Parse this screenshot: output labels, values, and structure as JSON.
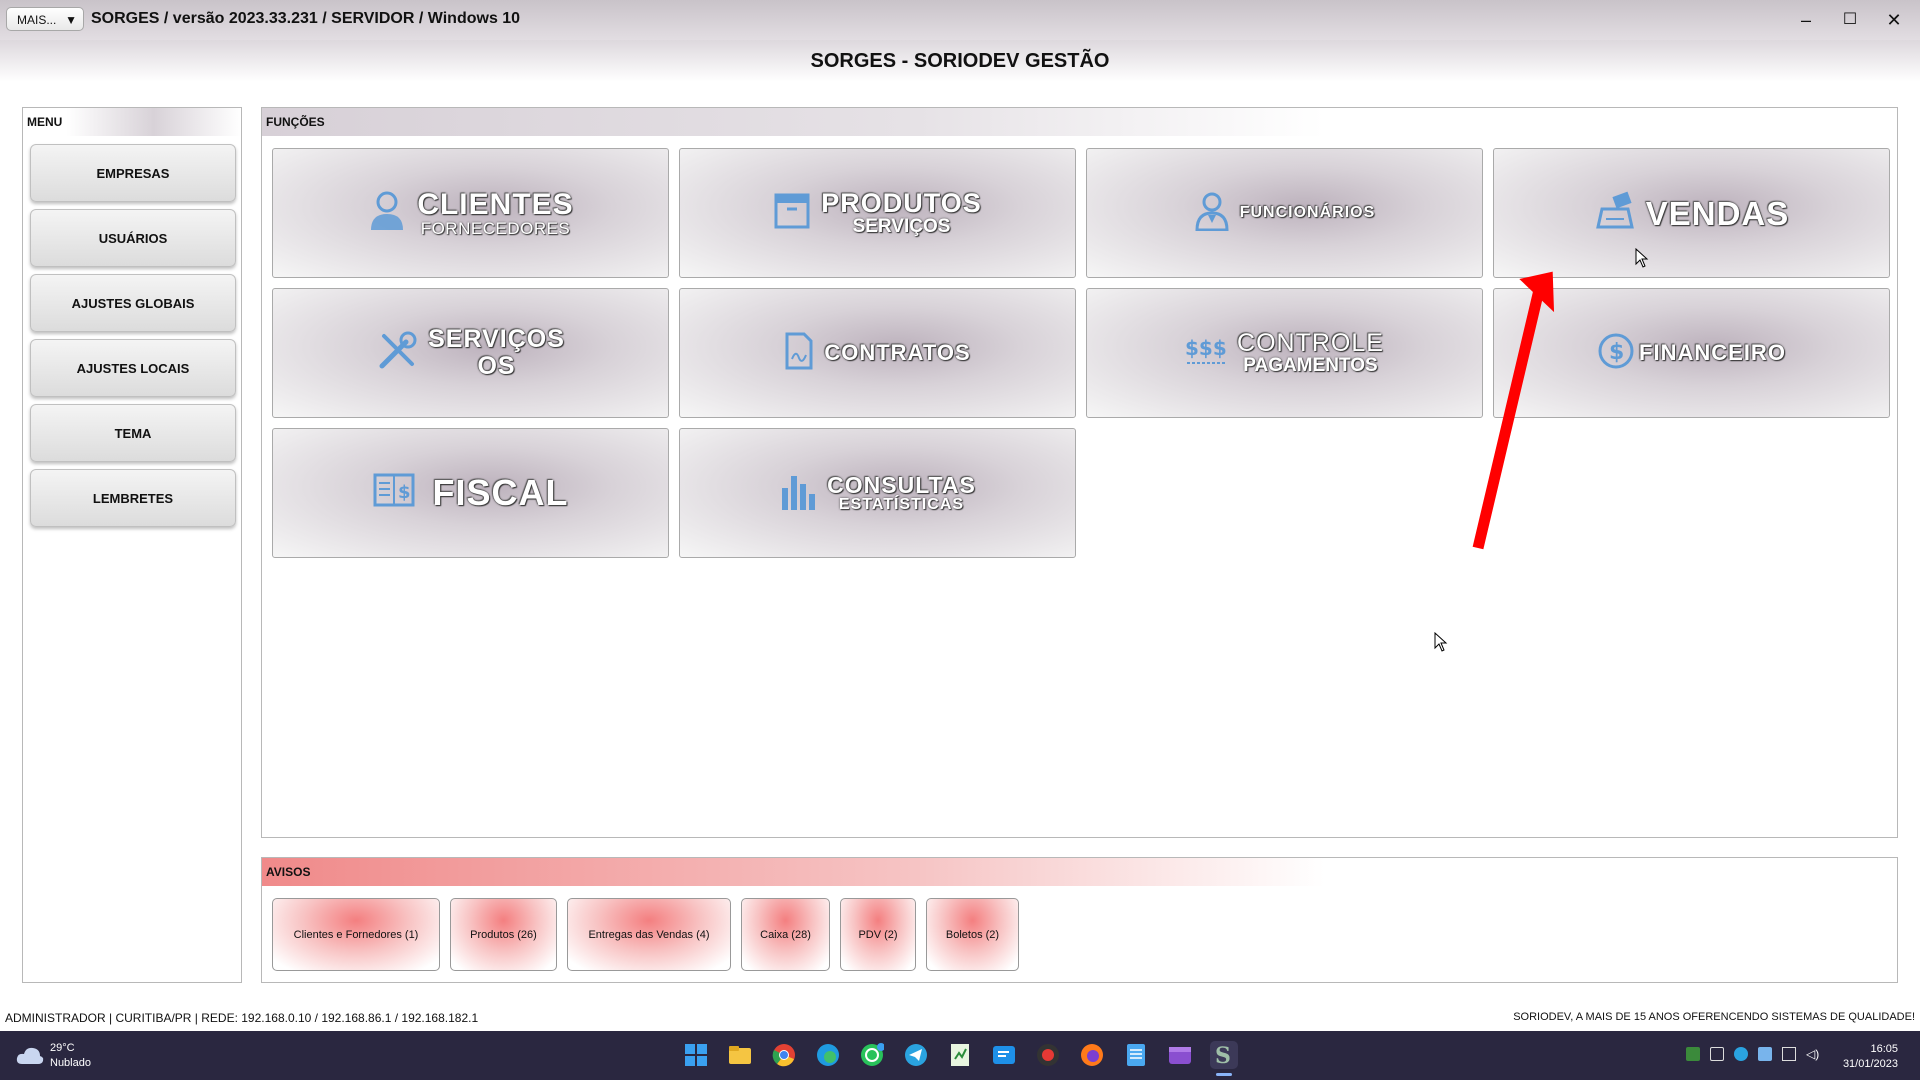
{
  "window": {
    "mais_label": "MAIS...",
    "title": "SORGES / versão 2023.33.231 / SERVIDOR / Windows 10",
    "app_header": "SORGES - SORIODEV GESTÃO",
    "minimize": "–",
    "maximize": "☐",
    "close": "✕"
  },
  "menu": {
    "label": "MENU",
    "items": [
      "EMPRESAS",
      "USUÁRIOS",
      "AJUSTES GLOBAIS",
      "AJUSTES LOCAIS",
      "TEMA",
      "LEMBRETES"
    ]
  },
  "funcoes": {
    "label": "FUNÇÕES",
    "tiles": [
      {
        "main": "CLIENTES",
        "sub": "FORNECEDORES",
        "icon": "person-icon"
      },
      {
        "main": "PRODUTOS",
        "sub": "SERVIÇOS",
        "icon": "box-icon"
      },
      {
        "main": "FUNCIONÁRIOS",
        "sub": "",
        "icon": "employee-icon"
      },
      {
        "main": "VENDAS",
        "sub": "",
        "icon": "cash-register-icon"
      },
      {
        "main": "SERVIÇOS",
        "sub": "OS",
        "icon": "tools-icon"
      },
      {
        "main": "CONTRATOS",
        "sub": "",
        "icon": "contract-icon"
      },
      {
        "main": "CONTROLE",
        "sub": "PAGAMENTOS",
        "icon": "dollar-signs-icon"
      },
      {
        "main": "FINANCEIRO",
        "sub": "",
        "icon": "dollar-coin-icon"
      },
      {
        "main": "FISCAL",
        "sub": "",
        "icon": "fiscal-book-icon"
      },
      {
        "main": "CONSULTAS",
        "sub": "ESTATÍSTICAS",
        "icon": "bar-chart-icon"
      }
    ]
  },
  "avisos": {
    "label": "AVISOS",
    "items": [
      "Clientes e Fornedores (1)",
      "Produtos (26)",
      "Entregas das Vendas (4)",
      "Caixa (28)",
      "PDV (2)",
      "Boletos (2)"
    ]
  },
  "status": {
    "left": "ADMINISTRADOR |   CURITIBA/PR |   REDE: 192.168.0.10 / 192.168.86.1 / 192.168.182.1",
    "right": "SORIODEV, A MAIS DE 15 ANOS OFERENCENDO SISTEMAS DE QUALIDADE!"
  },
  "taskbar": {
    "temperature": "29°C",
    "weather": "Nublado",
    "time": "16:05",
    "date": "31/01/2023",
    "apps": [
      "start-icon",
      "file-explorer-icon",
      "chrome-icon",
      "edge-icon",
      "whatsapp-icon",
      "telegram-icon",
      "sheet-icon",
      "mail-icon",
      "app-red-icon",
      "firefox-icon",
      "notepad-icon",
      "media-icon",
      "sorges-icon"
    ]
  },
  "colors": {
    "tile_icon": "#5f9bd6",
    "avisos_accent": "#f08080",
    "taskbar": "#2a2740",
    "annotation_arrow": "#ff0000"
  }
}
